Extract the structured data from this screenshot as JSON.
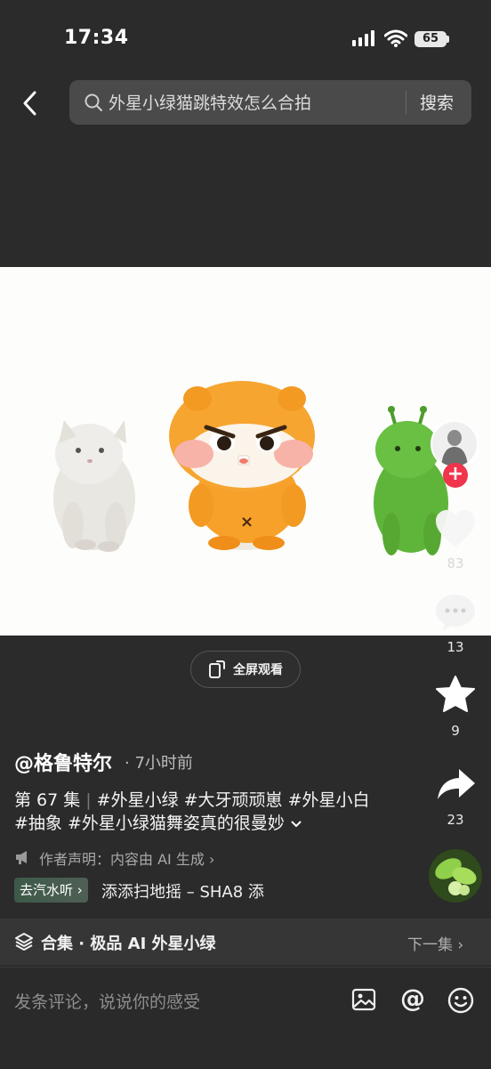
{
  "status_bar": {
    "time": "17:34",
    "battery": "65"
  },
  "search": {
    "query": "外星小绿猫跳特效怎么合拍",
    "button_label": "搜索"
  },
  "video": {
    "fullscreen_label": "全屏观看"
  },
  "rail": {
    "likes": "83",
    "comments": "13",
    "favorites": "9",
    "shares": "23"
  },
  "post": {
    "author": "@格鲁特尔",
    "time": "· 7小时前",
    "episode": "第 67 集",
    "tags_line1": "#外星小绿 #大牙顽顽崽 #外星小白",
    "tags_line2": "#抽象 #外星小绿猫舞姿真的很曼妙",
    "declaration": "作者声明：内容由 AI 生成",
    "listen_badge": "去汽水听",
    "music": "添添扫地摇 – SHA8    添"
  },
  "collection": {
    "label": "合集 · 极品 AI 外星小绿",
    "next": "下一集"
  },
  "comment_bar": {
    "placeholder": "发条评论，说说你的感受",
    "at_symbol": "@"
  }
}
